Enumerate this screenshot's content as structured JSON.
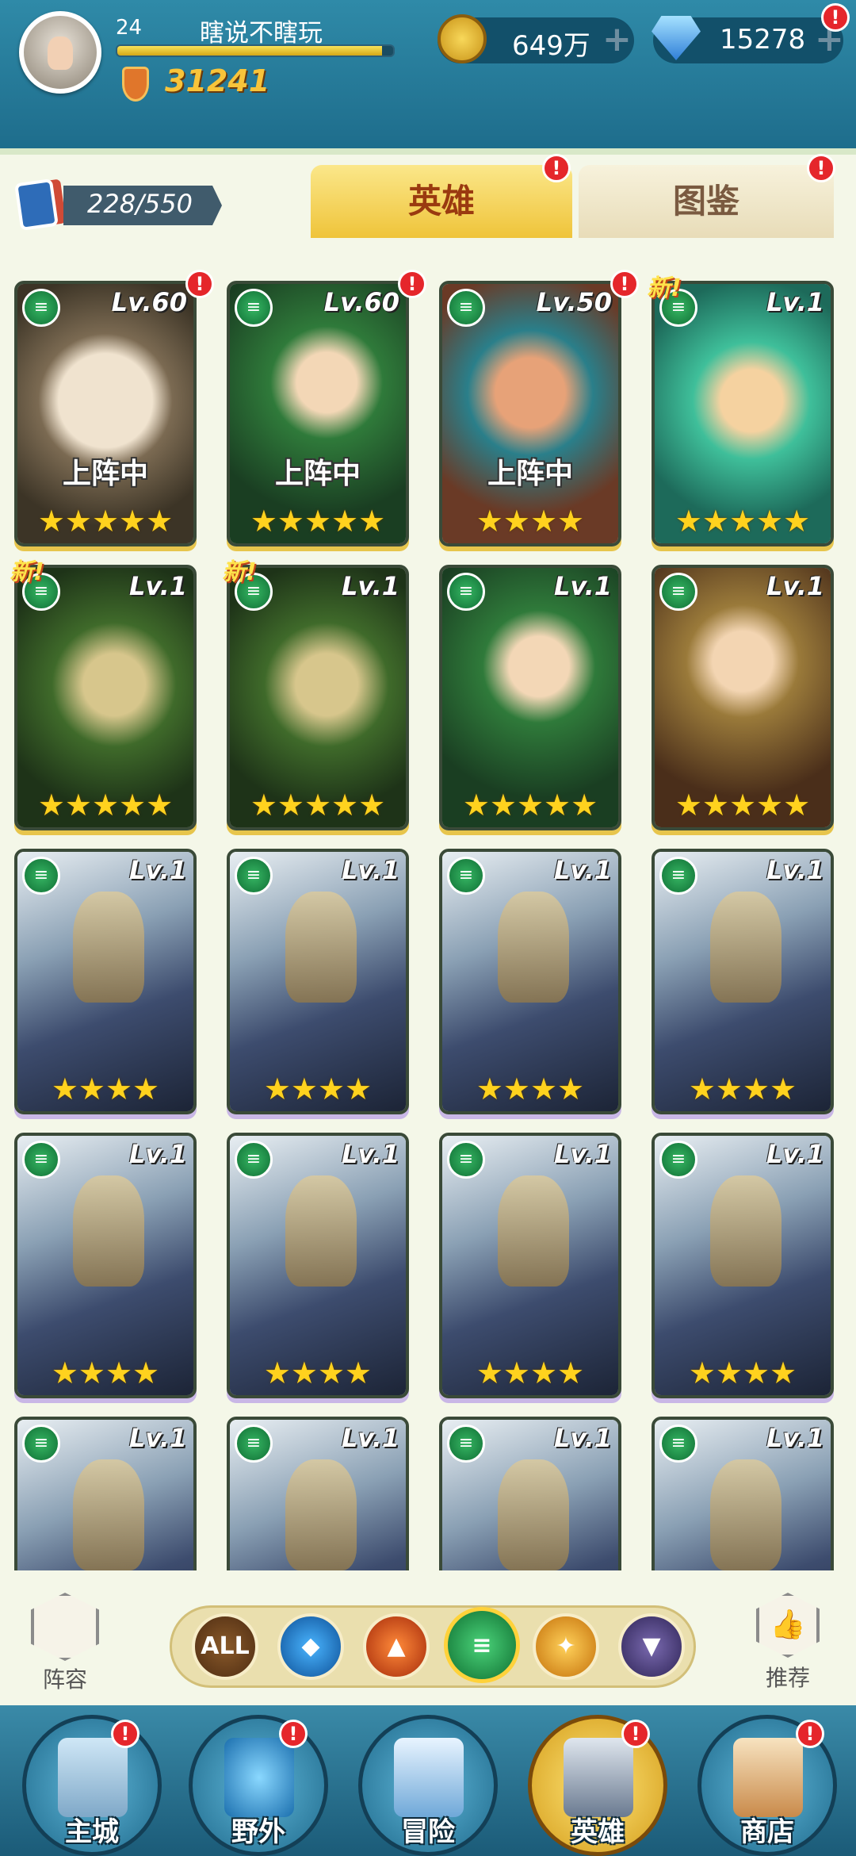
{
  "player": {
    "level": "24",
    "name": "瞎说不瞎玩",
    "exp_fraction": 0.96,
    "power": "31241"
  },
  "resources": {
    "gold": "649万",
    "gems": "15278",
    "plus": "+"
  },
  "alert_symbol": "!",
  "heroes": {
    "count": "228/550"
  },
  "tabs": [
    {
      "label": "英雄"
    },
    {
      "label": "图鉴"
    }
  ],
  "deploy_label": "上阵中",
  "new_label": "新!",
  "cards": [
    {
      "lv": "Lv.60",
      "stars": "★★★★★",
      "deployed": true,
      "art": "beast-hero-portrait"
    },
    {
      "lv": "Lv.60",
      "stars": "★★★★★",
      "deployed": true,
      "art": "elf-archer-portrait"
    },
    {
      "lv": "Lv.50",
      "stars": "★★★★",
      "deployed": true,
      "art": "mouse-hero-portrait"
    },
    {
      "lv": "Lv.1",
      "stars": "★★★★★",
      "new": true,
      "art": "nature-spirit-portrait"
    },
    {
      "lv": "Lv.1",
      "stars": "★★★★★",
      "new": true,
      "art": "horned-druid-portrait"
    },
    {
      "lv": "Lv.1",
      "stars": "★★★★★",
      "new": true,
      "art": "horned-druid-portrait"
    },
    {
      "lv": "Lv.1",
      "stars": "★★★★★",
      "art": "elf-archer-portrait"
    },
    {
      "lv": "Lv.1",
      "stars": "★★★★★",
      "art": "blonde-elf-portrait"
    },
    {
      "lv": "Lv.1",
      "stars": "★★★★",
      "art": "armored-knight-portrait"
    },
    {
      "lv": "Lv.1",
      "stars": "★★★★",
      "art": "armored-knight-portrait"
    },
    {
      "lv": "Lv.1",
      "stars": "★★★★",
      "art": "armored-knight-portrait"
    },
    {
      "lv": "Lv.1",
      "stars": "★★★★",
      "art": "armored-knight-portrait"
    },
    {
      "lv": "Lv.1",
      "stars": "★★★★",
      "art": "armored-knight-portrait"
    },
    {
      "lv": "Lv.1",
      "stars": "★★★★",
      "art": "armored-knight-portrait"
    },
    {
      "lv": "Lv.1",
      "stars": "★★★★",
      "art": "armored-knight-portrait"
    },
    {
      "lv": "Lv.1",
      "stars": "★★★★",
      "art": "armored-knight-portrait"
    },
    {
      "lv": "Lv.1",
      "stars": "",
      "art": "armored-knight-portrait"
    },
    {
      "lv": "Lv.1",
      "stars": "",
      "art": "armored-knight-portrait"
    },
    {
      "lv": "Lv.1",
      "stars": "",
      "art": "armored-knight-portrait"
    },
    {
      "lv": "Lv.1",
      "stars": "",
      "art": "armored-knight-portrait"
    }
  ],
  "filters": {
    "all_label": "ALL",
    "selected": "nature"
  },
  "lineup_label": "阵容",
  "recommend_label": "推荐",
  "nav": [
    {
      "label": "主城"
    },
    {
      "label": "野外"
    },
    {
      "label": "冒险"
    },
    {
      "label": "英雄"
    },
    {
      "label": "商店"
    }
  ]
}
